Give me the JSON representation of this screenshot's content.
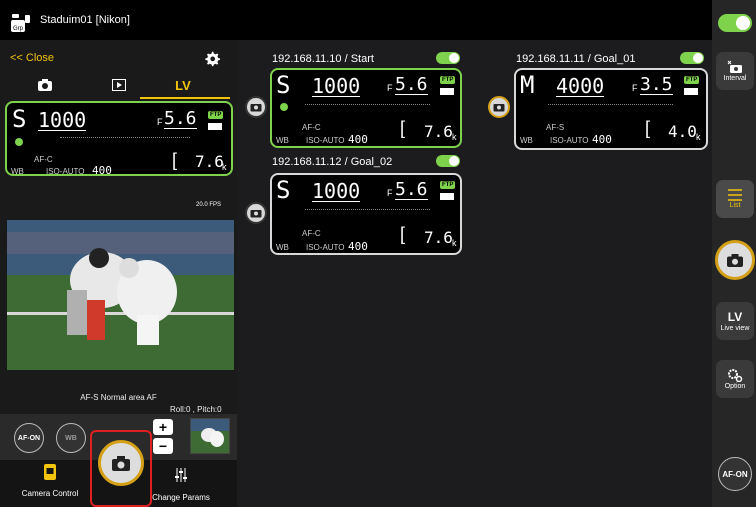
{
  "app": {
    "title": "Staduim01 [Nikon]"
  },
  "left_panel": {
    "close_label": "<< Close",
    "tabs": [
      {
        "id": "photo",
        "icon": "camera-icon"
      },
      {
        "id": "playback",
        "icon": "playback-icon"
      },
      {
        "id": "lv",
        "label": "LV"
      }
    ],
    "fps": "20.0 FPS",
    "af_status": "AF-S  Normal area AF",
    "roll_pitch": "Roll:0 , Pitch:0",
    "af_on_label": "AF-ON",
    "wb_label": "WB",
    "zoom_in": "+",
    "zoom_out": "−"
  },
  "main_card": {
    "mode": "S",
    "shutter": "1000",
    "aperture_prefix": "F",
    "aperture": "5.6",
    "ftp": "FTP",
    "af": "AF-C",
    "wb": "WB",
    "iso_label": "ISO-AUTO",
    "iso": "400",
    "shots": "7.6",
    "k": "k"
  },
  "cameras": [
    {
      "label": "192.168.11.10 / Start",
      "mode": "S",
      "shutter": "1000",
      "aperture": "5.6",
      "af": "AF-C",
      "iso_label": "ISO-AUTO",
      "iso": "400",
      "shots": "7.6",
      "k": "k",
      "ftp": "FTP",
      "wb": "WB",
      "f": "F"
    },
    {
      "label": "192.168.11.12 / Goal_02",
      "mode": "S",
      "shutter": "1000",
      "aperture": "5.6",
      "af": "AF-C",
      "iso_label": "ISO-AUTO",
      "iso": "400",
      "shots": "7.6",
      "k": "k",
      "ftp": "FTP",
      "wb": "WB",
      "f": "F"
    },
    {
      "label": "192.168.11.11 / Goal_01",
      "mode": "M",
      "shutter": "4000",
      "aperture": "3.5",
      "af": "AF-S",
      "iso_label": "ISO-AUTO",
      "iso": "400",
      "shots": "4.0",
      "k": "k",
      "ftp": "FTP",
      "wb": "WB",
      "f": "F"
    }
  ],
  "bottom_nav": {
    "camera_control": "Camera Control",
    "change_params": "Change Params"
  },
  "right_sidebar": {
    "interval": "Interval",
    "list": "List",
    "lv": "LV",
    "live_view": "Live view",
    "option": "Option",
    "af_on": "AF-ON"
  },
  "colors": {
    "accent": "#f2c40c",
    "active_border": "#7fd24c",
    "toggle_on": "#7fd24c"
  }
}
